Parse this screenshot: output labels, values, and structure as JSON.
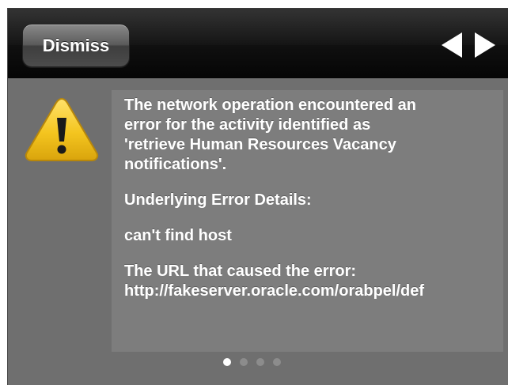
{
  "toolbar": {
    "dismiss_label": "Dismiss"
  },
  "icons": {
    "warning": "warning-icon",
    "prev": "left-arrow-icon",
    "next": "right-arrow-icon"
  },
  "colors": {
    "toolbar_background": "#000000",
    "panel_background": "#6f6f6f",
    "message_background": "#7d7d7d",
    "warning_yellow": "#f2c522",
    "text": "#ffffff"
  },
  "message": {
    "intro": "The network operation encountered an\nerror for the activity identified as\n'retrieve Human Resources Vacancy\nnotifications'.",
    "details_heading": "Underlying Error Details:",
    "details": "can't find host",
    "url_label": "The URL that caused the error:",
    "url": "http://fakeserver.oracle.com/orabpel/def"
  },
  "pager": {
    "page_count": 4,
    "current_page": 1
  }
}
